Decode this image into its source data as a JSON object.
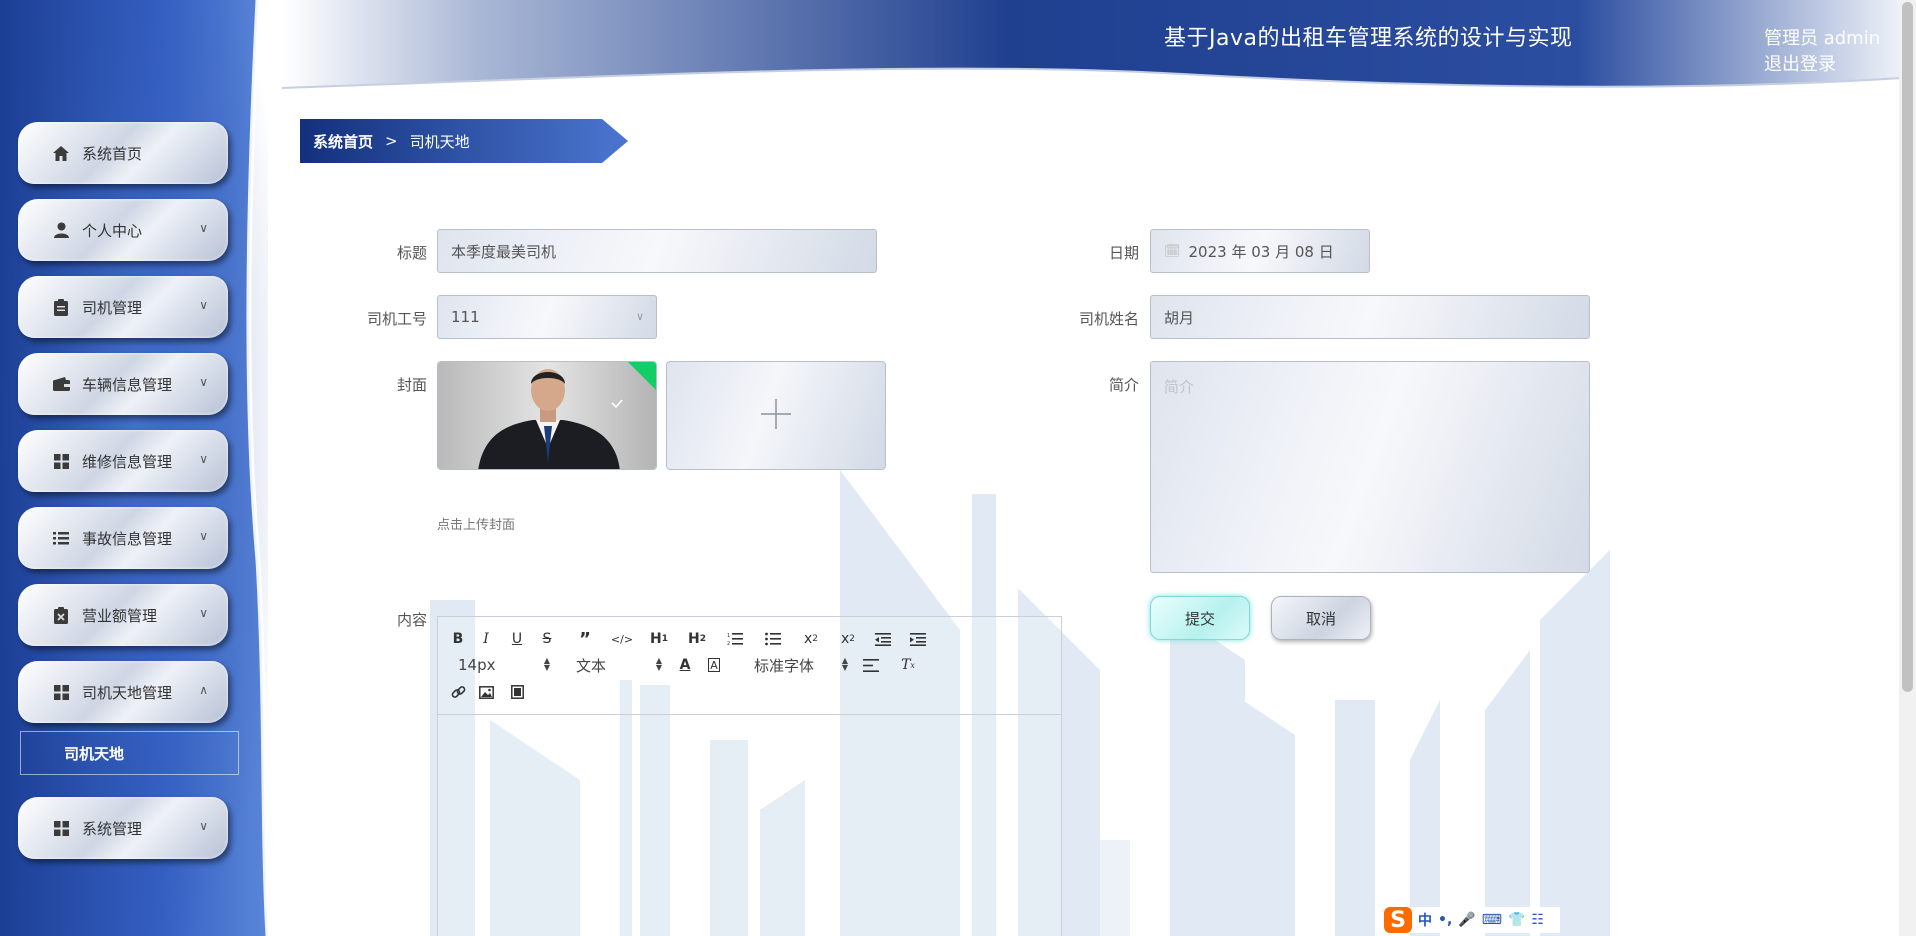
{
  "header": {
    "title": "基于Java的出租车管理系统的设计与实现",
    "user_label": "管理员 admin",
    "logout_label": "退出登录"
  },
  "sidebar": {
    "items": [
      {
        "label": "系统首页",
        "icon": "home-icon"
      },
      {
        "label": "个人中心",
        "icon": "user-icon",
        "expandable": true
      },
      {
        "label": "司机管理",
        "icon": "clipboard-icon",
        "expandable": true
      },
      {
        "label": "车辆信息管理",
        "icon": "wallet-icon",
        "expandable": true
      },
      {
        "label": "维修信息管理",
        "icon": "grid-icon",
        "expandable": true
      },
      {
        "label": "事故信息管理",
        "icon": "list-icon",
        "expandable": true
      },
      {
        "label": "营业额管理",
        "icon": "clipboard-x-icon",
        "expandable": true
      },
      {
        "label": "司机天地管理",
        "icon": "grid-icon",
        "expanded": true,
        "children": [
          "司机天地"
        ]
      },
      {
        "label": "系统管理",
        "icon": "grid-icon",
        "expandable": true
      }
    ]
  },
  "breadcrumb": {
    "home": "系统首页",
    "separator": ">",
    "current": "司机天地"
  },
  "form": {
    "title": {
      "label": "标题",
      "value": "本季度最美司机"
    },
    "date": {
      "label": "日期",
      "value": "2023 年 03 月 08 日"
    },
    "driver_no": {
      "label": "司机工号",
      "value": "111"
    },
    "driver_name": {
      "label": "司机姓名",
      "value": "胡月"
    },
    "cover": {
      "label": "封面",
      "hint": "点击上传封面"
    },
    "intro": {
      "label": "简介",
      "placeholder": "简介"
    },
    "content": {
      "label": "内容"
    },
    "submit_label": "提交",
    "cancel_label": "取消"
  },
  "editor": {
    "font_size": "14px",
    "text_type": "文本",
    "font_family": "标准字体"
  },
  "ime": {
    "mode": "中"
  },
  "colors": {
    "sidebar_blue": "#2349a3",
    "header_blue": "#1f3f8f",
    "accent_cyan": "#7fd9d4"
  }
}
